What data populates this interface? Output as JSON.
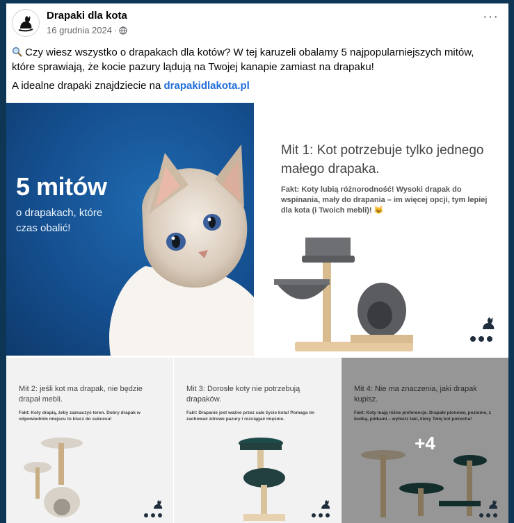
{
  "post": {
    "page_name": "Drapaki dla kota",
    "date": "16 grudnia 2024",
    "date_separator": "·",
    "privacy_icon": "globe-icon",
    "more_label": "···",
    "text_line1": "Czy wiesz wszystko o drapakach dla kotów? W tej karuzeli obalamy 5 najpopularniejszych mitów, które sprawiają, że kocie pazury lądują na Twojej kanapie zamiast na drapaku!",
    "lead_icon": "magnifier-icon",
    "text_line2_prefix": "A idealne drapaki znajdziecie na ",
    "link": "drapakidlakota.pl"
  },
  "slides": {
    "s1": {
      "title": "5 mitów",
      "subtitle": "o drapakach, które czas obalić!"
    },
    "s2": {
      "title": "Mit 1: Kot potrzebuje tylko jednego małego drapaka.",
      "fact": "Fakt: Koty lubią różnorodność! Wysoki drapak do wspinania, mały do drapania – im więcej opcji, tym lepiej dla kota (i Twoich mebli)! 😺"
    },
    "s3": {
      "title": "Mit 2: jeśli kot ma drapak, nie będzie drapał mebli.",
      "fact": "Fakt: Koty drapią, żeby zaznaczyć teren. Dobry drapak w odpowiednim miejscu to klucz do sukcesu!"
    },
    "s4": {
      "title": "Mit 3: Dorosłe koty nie potrzebują drapaków.",
      "fact": "Fakt: Drapanie jest ważne przez całe życie kota! Pomaga im zachować zdrowe pazury i rozciągać mięśnie."
    },
    "s5": {
      "title": "Mit 4: Nie ma znaczenia, jaki drapak kupisz.",
      "fact": "Fakt: Koty mają różne preferencje. Drapaki pionowe, poziome, z budką, półkami – wybierz taki, który Twój kot pokocha!",
      "more_count": "+4"
    }
  },
  "colors": {
    "link": "#216fdb",
    "bg": "#0f3554",
    "blue_slide": "#154f8f"
  }
}
